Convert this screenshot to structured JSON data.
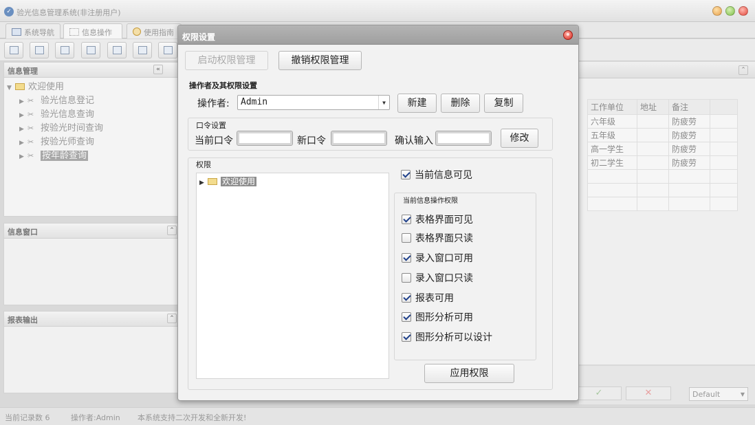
{
  "app": {
    "title": "验光信息管理系统(非注册用户)",
    "tabs": [
      {
        "label": "系统导航"
      },
      {
        "label": "信息操作"
      },
      {
        "label": "使用指南"
      }
    ]
  },
  "left_panel": {
    "title": "信息管理",
    "tree": {
      "root": "欢迎使用",
      "children": [
        "验光信息登记",
        "验光信息查询",
        "按验光时间查询",
        "按验光师查询",
        "按年龄查询"
      ]
    }
  },
  "info_window": {
    "title": "信息窗口"
  },
  "report_output": {
    "title": "报表输出"
  },
  "grid": {
    "headers": [
      "工作单位",
      "地址",
      "备注"
    ],
    "rows": [
      [
        "六年级",
        "",
        "防疲劳"
      ],
      [
        "五年级",
        "",
        "防疲劳"
      ],
      [
        "高一学生",
        "",
        "防疲劳"
      ],
      [
        "初二学生",
        "",
        "防疲劳"
      ],
      [
        "",
        "",
        ""
      ],
      [
        "",
        "",
        ""
      ],
      [
        "",
        "",
        ""
      ]
    ]
  },
  "bottom_right": {
    "ok": "✓",
    "cancel": "✕",
    "theme": "Default"
  },
  "status": {
    "record_count": "当前记录数 6",
    "operator": "操作者:Admin",
    "message": "本系统支持二次开发和全新开发!"
  },
  "dialog": {
    "title": "权限设置",
    "enable_button": "启动权限管理",
    "revoke_button": "撤销权限管理",
    "operator_section": "操作者及其权限设置",
    "operator_label": "操作者:",
    "operator_value": "Admin",
    "new_button": "新建",
    "delete_button": "删除",
    "copy_button": "复制",
    "password_section": "口令设置",
    "current_pw_label": "当前口令",
    "new_pw_label": "新口令",
    "confirm_label": "确认输入",
    "modify_button": "修改",
    "rights_section": "权限",
    "rights_tree_root": "欢迎使用",
    "current_visible": {
      "label": "当前信息可见",
      "checked": true
    },
    "ops_section": "当前信息操作权限",
    "ops": [
      {
        "label": "表格界面可见",
        "checked": true
      },
      {
        "label": "表格界面只读",
        "checked": false
      },
      {
        "label": "录入窗口可用",
        "checked": true
      },
      {
        "label": "录入窗口只读",
        "checked": false
      },
      {
        "label": "报表可用",
        "checked": true
      },
      {
        "label": "图形分析可用",
        "checked": true
      },
      {
        "label": "图形分析可以设计",
        "checked": true
      }
    ],
    "apply_button": "应用权限"
  }
}
